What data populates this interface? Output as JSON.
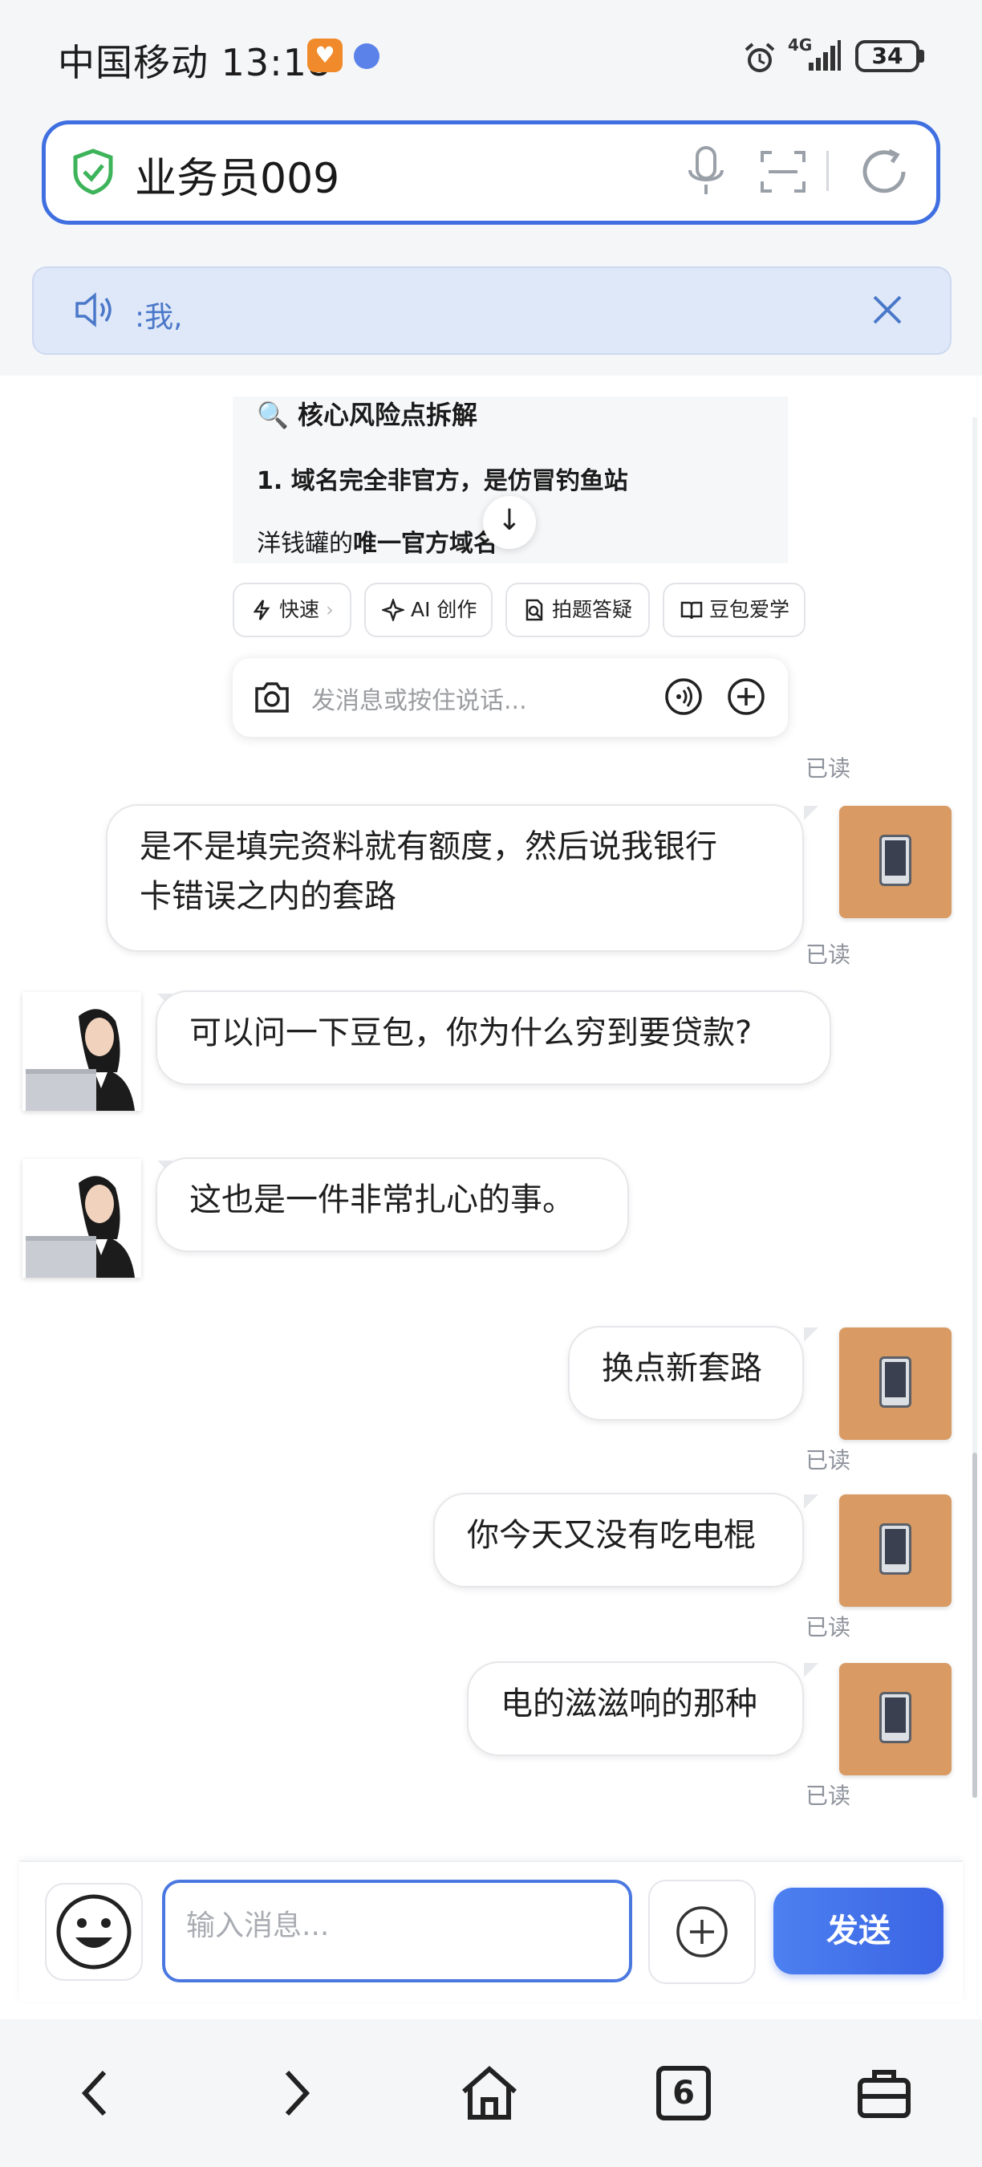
{
  "status_bar": {
    "carrier_time": "中国移动 13:18",
    "network": "4G",
    "battery": "34"
  },
  "search": {
    "query": "业务员009"
  },
  "tts_banner": {
    "text": ":我,"
  },
  "embedded_card": {
    "heading": "🔍 核心风险点拆解",
    "point1": "1. 域名完全非官方，是仿冒钓鱼站",
    "point2_prefix": "洋钱罐的",
    "point2_bold": "唯一官方域名",
    "chips": [
      "快速",
      "AI 创作",
      "拍题答疑",
      "豆包爱学"
    ],
    "input_placeholder": "发消息或按住说话..."
  },
  "chat": {
    "read_label": "已读",
    "messages": [
      {
        "side": "right",
        "text_line1": "是不是填完资料就有额度，然后说我银行",
        "text_line2": "卡错误之内的套路"
      },
      {
        "side": "left",
        "text": "可以问一下豆包，你为什么穷到要贷款?"
      },
      {
        "side": "left",
        "text": "这也是一件非常扎心的事。"
      },
      {
        "side": "right",
        "text": "换点新套路"
      },
      {
        "side": "right",
        "text": "你今天又没有吃电棍"
      },
      {
        "side": "right",
        "text": "电的滋滋响的那种"
      }
    ]
  },
  "composer": {
    "placeholder": "输入消息...",
    "send_label": "发送"
  },
  "nav": {
    "tabs_count": "6"
  },
  "colors": {
    "accent": "#3f6fe0",
    "user_avatar": "#d99a63",
    "send_button": "#4a78e8"
  }
}
